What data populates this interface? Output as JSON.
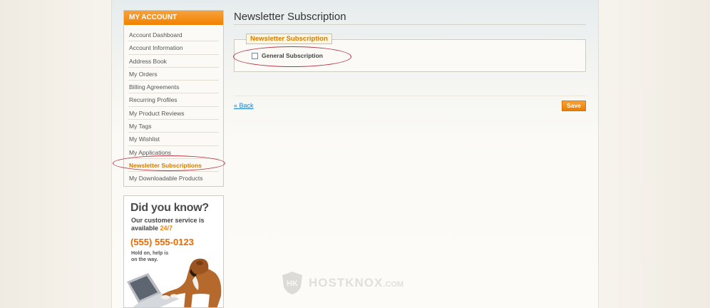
{
  "sidebar": {
    "heading": "MY ACCOUNT",
    "items": [
      {
        "label": "Account Dashboard",
        "active": false
      },
      {
        "label": "Account Information",
        "active": false
      },
      {
        "label": "Address Book",
        "active": false
      },
      {
        "label": "My Orders",
        "active": false
      },
      {
        "label": "Billing Agreements",
        "active": false
      },
      {
        "label": "Recurring Profiles",
        "active": false
      },
      {
        "label": "My Product Reviews",
        "active": false
      },
      {
        "label": "My Tags",
        "active": false
      },
      {
        "label": "My Wishlist",
        "active": false
      },
      {
        "label": "My Applications",
        "active": false
      },
      {
        "label": "Newsletter Subscriptions",
        "active": true
      },
      {
        "label": "My Downloadable Products",
        "active": false
      }
    ]
  },
  "ad": {
    "title": "Did you know?",
    "line1": "Our customer service is available",
    "line1_highlight": "24/7",
    "phone": "(555) 555-0123",
    "hold": "Hold on, help is on the way."
  },
  "main": {
    "page_title": "Newsletter Subscription",
    "fieldset_legend": "Newsletter Subscription",
    "checkbox_label": "General Subscription",
    "checkbox_checked": false,
    "back_link": "« Back",
    "save_button": "Save"
  },
  "watermark": {
    "brand": "HOSTKNOX",
    "suffix": ".COM"
  },
  "colors": {
    "accent": "#f18200",
    "link": "#1e7ec8",
    "highlight_oval": "#b7313f"
  }
}
